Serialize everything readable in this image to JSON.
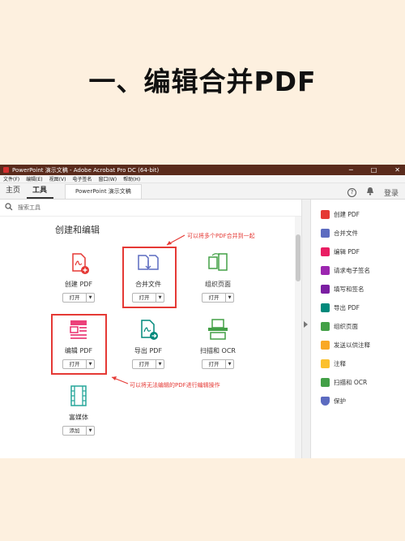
{
  "headline": "一、编辑合并PDF",
  "window": {
    "title": "PowerPoint 演示文稿 - Adobe Acrobat Pro DC (64-bit)",
    "controls": [
      "─",
      "□",
      "✕"
    ]
  },
  "menu": [
    "文件(F)",
    "编辑(E)",
    "视图(V)",
    "电子签名",
    "窗口(W)",
    "帮助(H)"
  ],
  "tabs": {
    "home": "主页",
    "tools": "工具",
    "document": "PowerPoint 演示文稿",
    "login": "登录"
  },
  "search": {
    "placeholder": "搜索工具"
  },
  "section_title": "创建和编辑",
  "tools": [
    {
      "label": "创建 PDF",
      "button": "打开",
      "icon": "create-pdf-icon",
      "color": "#e53935"
    },
    {
      "label": "合并文件",
      "button": "打开",
      "icon": "combine-files-icon",
      "color": "#5c6bc0"
    },
    {
      "label": "组织页面",
      "button": "打开",
      "icon": "organize-pages-icon",
      "color": "#43a047"
    },
    {
      "label": "编辑 PDF",
      "button": "打开",
      "icon": "edit-pdf-icon",
      "color": "#e91e63"
    },
    {
      "label": "导出 PDF",
      "button": "打开",
      "icon": "export-pdf-icon",
      "color": "#00897b"
    },
    {
      "label": "扫描和 OCR",
      "button": "打开",
      "icon": "scan-ocr-icon",
      "color": "#43a047"
    },
    {
      "label": "富媒体",
      "button": "添加",
      "icon": "rich-media-icon",
      "color": "#26a69a"
    }
  ],
  "annotations": {
    "combine": "可以将多个PDF合并到一起",
    "edit": "可以将无法编辑的PDF进行编辑操作"
  },
  "right_panel": [
    {
      "label": "创建 PDF",
      "icon": "create-pdf-icon",
      "color": "#e53935"
    },
    {
      "label": "合并文件",
      "icon": "combine-files-icon",
      "color": "#5c6bc0"
    },
    {
      "label": "编辑 PDF",
      "icon": "edit-pdf-icon",
      "color": "#e91e63"
    },
    {
      "label": "请求电子签名",
      "icon": "request-signature-icon",
      "color": "#9c27b0"
    },
    {
      "label": "填写和签名",
      "icon": "fill-sign-icon",
      "color": "#7b1fa2"
    },
    {
      "label": "导出 PDF",
      "icon": "export-pdf-icon",
      "color": "#00897b"
    },
    {
      "label": "组织页面",
      "icon": "organize-pages-icon",
      "color": "#43a047"
    },
    {
      "label": "发送以供注释",
      "icon": "send-comment-icon",
      "color": "#f9a825"
    },
    {
      "label": "注释",
      "icon": "comment-icon",
      "color": "#fbc02d"
    },
    {
      "label": "扫描和 OCR",
      "icon": "scan-ocr-icon",
      "color": "#43a047"
    },
    {
      "label": "保护",
      "icon": "protect-icon",
      "color": "#5c6bc0"
    }
  ]
}
